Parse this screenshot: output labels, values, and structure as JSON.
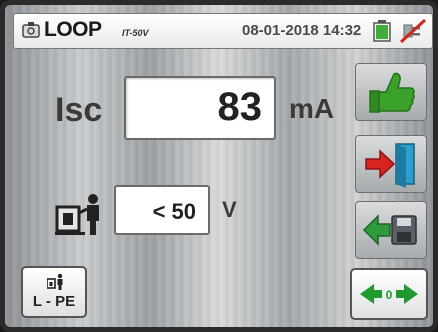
{
  "header": {
    "title": "LOOP",
    "subtitle": "IT-50V",
    "datetime": "08-01-2018 14:32",
    "icons": [
      "loop-icon",
      "battery-icon",
      "no-connection-plug-icon"
    ]
  },
  "measurement": {
    "label": "Isc",
    "value": "83",
    "unit": "mA"
  },
  "touch_voltage": {
    "icon": "touch-voltage-icon",
    "value": "< 50",
    "unit": "V"
  },
  "buttons": {
    "result_ok": {
      "icon": "thumbs-up-icon",
      "color": "#3aa12a"
    },
    "exit": {
      "icon": "exit-door-icon",
      "color": "#d8231f"
    },
    "save": {
      "icon": "save-icon",
      "color": "#2f9a3c"
    },
    "lpe_label": "L - PE",
    "zero": {
      "icon": "zero-calibration-icon",
      "color": "#1f9a2e"
    }
  },
  "colors": {
    "battery_fill": "#3fae3a",
    "plug_cross": "#d8231f"
  }
}
